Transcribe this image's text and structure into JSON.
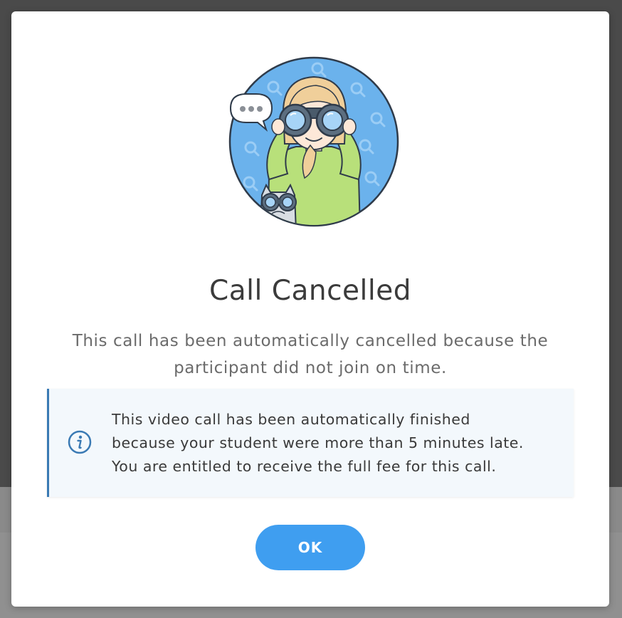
{
  "dialog": {
    "title": "Call Cancelled",
    "description": "This call has been automatically cancelled because the participant did not join on time.",
    "notice": {
      "icon": "info-icon",
      "lines": [
        "This video call has been automatically finished",
        "because your student were more than 5 minutes late.",
        "You are entitled to receive the full fee for this call."
      ]
    },
    "ok_label": "OK"
  },
  "colors": {
    "accent": "#3f9ef0",
    "notice_border": "#3a7ab4",
    "notice_bg": "#f3f8fc",
    "illustration_bg": "#6bb2ec"
  }
}
